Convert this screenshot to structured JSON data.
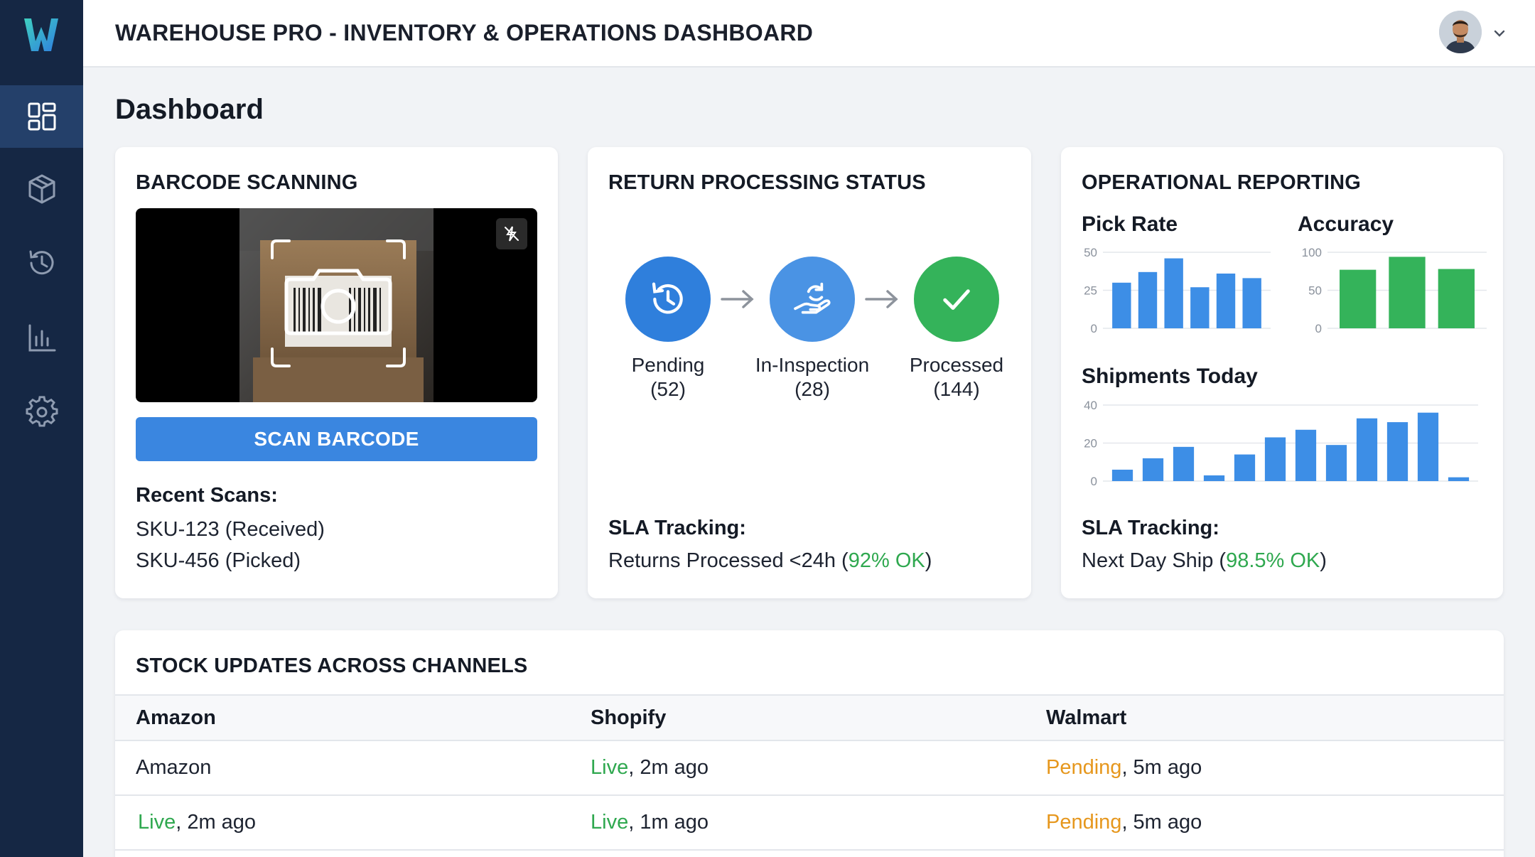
{
  "header": {
    "title": "WAREHOUSE PRO - INVENTORY & OPERATIONS DASHBOARD"
  },
  "sidebar": {
    "items": [
      {
        "icon": "dashboard-icon",
        "active": true
      },
      {
        "icon": "package-icon",
        "active": false
      },
      {
        "icon": "history-icon",
        "active": false
      },
      {
        "icon": "bar-chart-icon",
        "active": false
      },
      {
        "icon": "gear-icon",
        "active": false
      }
    ]
  },
  "page": {
    "title": "Dashboard"
  },
  "barcode": {
    "title": "BARCODE SCANNING",
    "button_label": "SCAN BARCODE",
    "recent_heading": "Recent Scans:",
    "recent": [
      "SKU-123 (Received)",
      "SKU-456 (Picked)"
    ]
  },
  "returns": {
    "title": "RETURN PROCESSING STATUS",
    "steps": [
      {
        "label": "Pending",
        "count": "(52)",
        "color": "#2f7fdc",
        "icon": "history-icon"
      },
      {
        "label": "In-Inspection",
        "count": "(28)",
        "color": "#4a93e4",
        "icon": "hand-return-icon"
      },
      {
        "label": "Processed",
        "count": "(144)",
        "color": "#34b35a",
        "icon": "checkmark-icon"
      }
    ],
    "sla_heading": "SLA Tracking:",
    "sla_prefix": "Returns Processed <24h (",
    "sla_value": "92% OK",
    "sla_suffix": ")"
  },
  "reporting": {
    "title": "OPERATIONAL REPORTING",
    "sla_heading": "SLA Tracking:",
    "sla_prefix": "Next Day Ship (",
    "sla_value": "98.5% OK",
    "sla_suffix": ")"
  },
  "chart_data": [
    {
      "type": "bar",
      "title": "Pick Rate",
      "ylim": [
        0,
        50
      ],
      "yticks": [
        "0",
        "25",
        "50"
      ],
      "values": [
        30,
        37,
        46,
        27,
        36,
        33
      ],
      "color": "#3d8ee6"
    },
    {
      "type": "bar",
      "title": "Accuracy",
      "ylim": [
        0,
        100
      ],
      "yticks": [
        "0",
        "50",
        "100"
      ],
      "values": [
        77,
        94,
        78
      ],
      "color": "#34b35a"
    },
    {
      "type": "bar",
      "title": "Shipments Today",
      "ylim": [
        0,
        40
      ],
      "yticks": [
        "0",
        "20",
        "40"
      ],
      "values": [
        6,
        12,
        18,
        3,
        14,
        23,
        27,
        19,
        33,
        31,
        36,
        2
      ],
      "color": "#3d8ee6"
    }
  ],
  "stock": {
    "title": "STOCK UPDATES ACROSS CHANNELS",
    "columns": [
      "Amazon",
      "Shopify",
      "Walmart"
    ],
    "rows": [
      [
        {
          "status": "",
          "time": "Amazon"
        },
        {
          "status": "Live",
          "time": ", 2m ago"
        },
        {
          "status": "Pending",
          "time": ", 5m ago"
        }
      ],
      [
        {
          "status": "Live",
          "time": ", 2m ago"
        },
        {
          "status": "Live",
          "time": ", 1m ago"
        },
        {
          "status": "Pending",
          "time": ", 5m ago"
        }
      ]
    ]
  },
  "colors": {
    "primary": "#3a86e0",
    "ok": "#2fa84f",
    "pending": "#e6971d",
    "sidebar": "#152744"
  }
}
